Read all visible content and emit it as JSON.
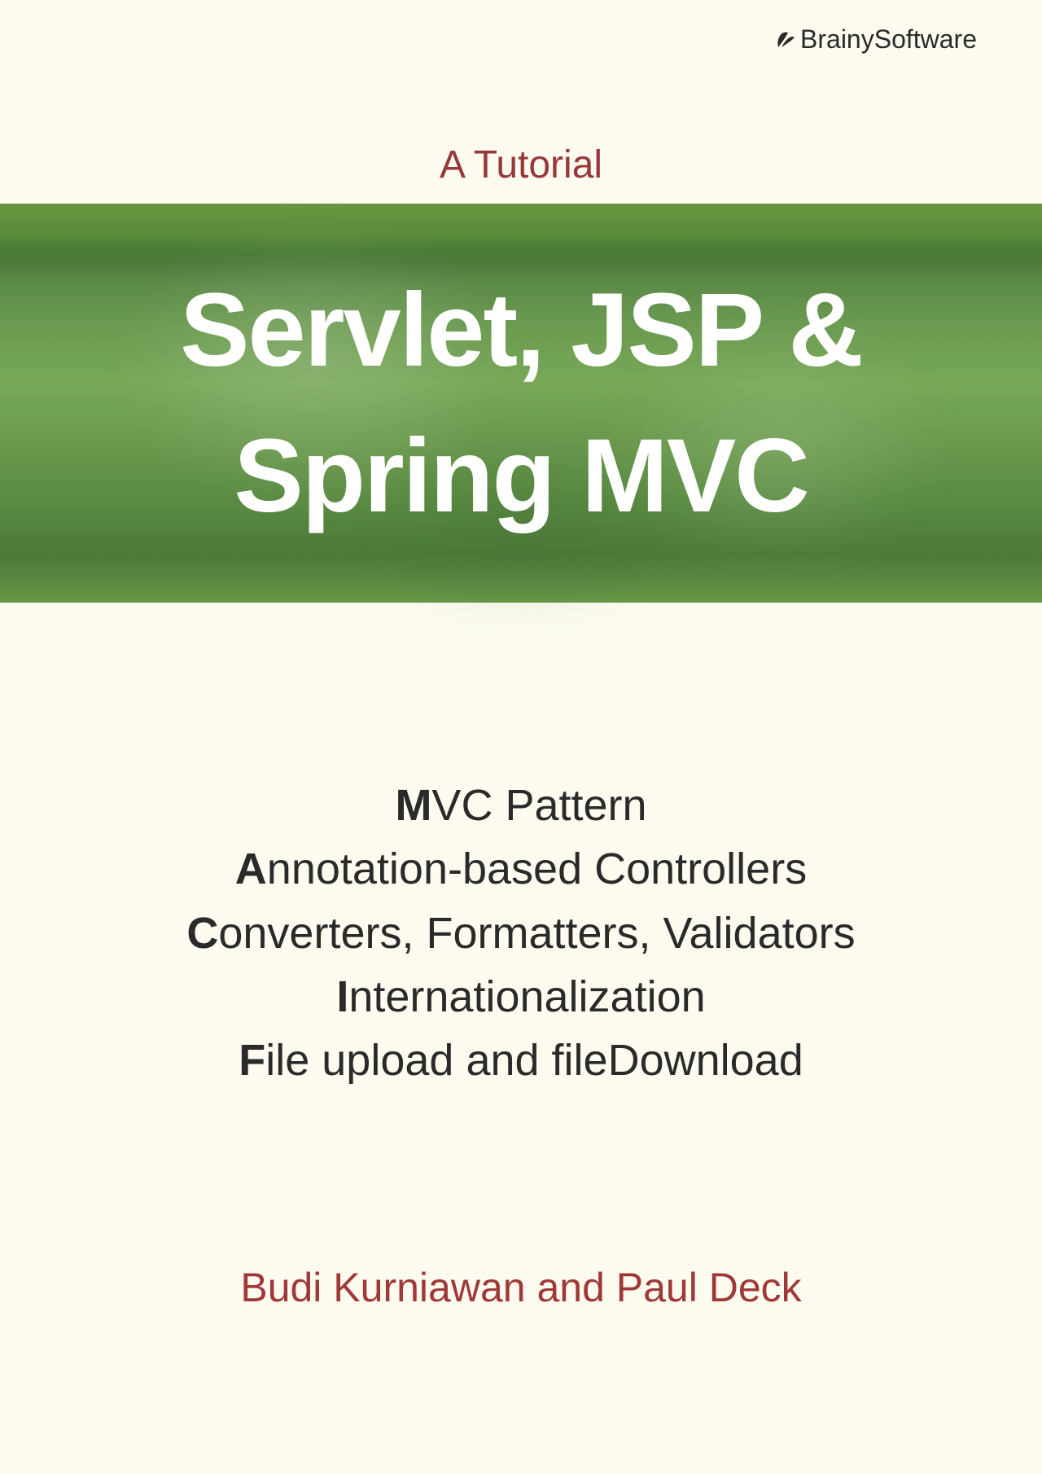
{
  "publisher": {
    "name": "BrainySoftware"
  },
  "subtitle": "A Tutorial",
  "title": {
    "line1": "Servlet, JSP &",
    "line2": "Spring MVC"
  },
  "topics": [
    {
      "bold": "M",
      "rest": "VC Pattern"
    },
    {
      "bold": "A",
      "rest": "nnotation-based Controllers"
    },
    {
      "bold": "C",
      "rest": "onverters, Formatters, Validators"
    },
    {
      "bold": "I",
      "rest": "nternationalization"
    },
    {
      "bold": "F",
      "rest": "ile upload and fileDownload"
    }
  ],
  "authors": "Budi Kurniawan and Paul Deck"
}
